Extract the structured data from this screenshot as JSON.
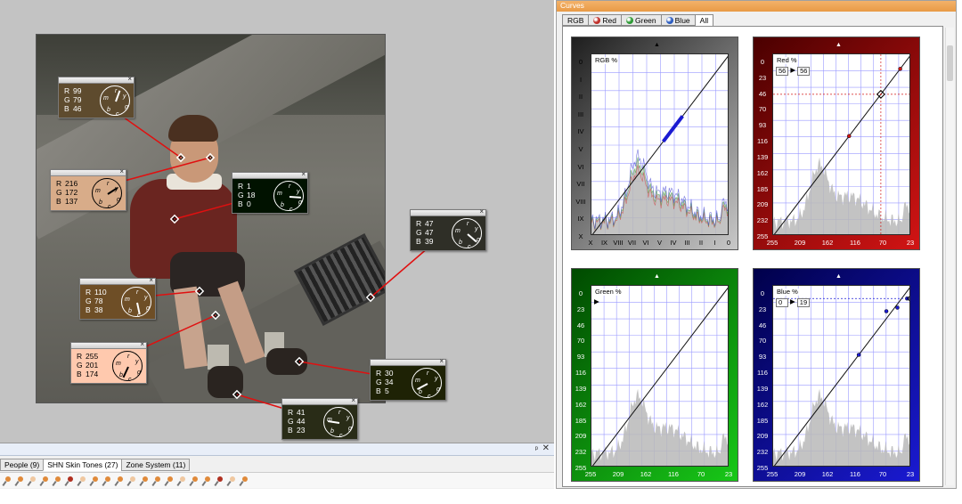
{
  "window": {
    "title": "Curves"
  },
  "curve_tabs": [
    {
      "label": "RGB",
      "ball": ""
    },
    {
      "label": "Red",
      "ball": "#c0302a"
    },
    {
      "label": "Green",
      "ball": "#2e9a35"
    },
    {
      "label": "Blue",
      "ball": "#2b5cc0"
    },
    {
      "label": "All",
      "ball": ""
    }
  ],
  "active_curve_tab": "All",
  "panels": {
    "rgb": {
      "title": "RGB %",
      "y_labels": [
        "0",
        "I",
        "II",
        "III",
        "IV",
        "V",
        "VI",
        "VII",
        "VIII",
        "IX",
        "X"
      ],
      "x_labels": [
        "X",
        "IX",
        "VIII",
        "VII",
        "VI",
        "V",
        "IV",
        "III",
        "II",
        "I",
        "0"
      ],
      "bg_from": "#1e1e1e",
      "bg_to": "#c8c8c8"
    },
    "red": {
      "title": "Red %",
      "readout_in": "56",
      "readout_arrow": "▶",
      "readout_out": "56",
      "y_labels": [
        "0",
        "23",
        "46",
        "70",
        "93",
        "116",
        "139",
        "162",
        "185",
        "209",
        "232",
        "255"
      ],
      "x_labels": [
        "255",
        "209",
        "162",
        "116",
        "70",
        "23"
      ],
      "color": "#d21414",
      "bg_dark": "#4a0000"
    },
    "green": {
      "title": "Green %",
      "readout_arrow": "▶",
      "y_labels": [
        "0",
        "23",
        "46",
        "70",
        "93",
        "116",
        "139",
        "162",
        "185",
        "209",
        "232",
        "255"
      ],
      "x_labels": [
        "255",
        "209",
        "162",
        "116",
        "70",
        "23"
      ],
      "color": "#18c818",
      "bg_dark": "#004a00"
    },
    "blue": {
      "title": "Blue %",
      "readout_in": "0",
      "readout_arrow": "▶",
      "readout_out": "19",
      "y_labels": [
        "0",
        "23",
        "46",
        "70",
        "93",
        "116",
        "139",
        "162",
        "185",
        "209",
        "232",
        "255"
      ],
      "x_labels": [
        "255",
        "209",
        "162",
        "116",
        "70",
        "23"
      ],
      "color": "#1a1ad2",
      "bg_dark": "#00004a"
    }
  },
  "probes": [
    {
      "id": "p1",
      "r": "99",
      "g": "79",
      "b": "46",
      "color": "#5e4b2e",
      "text": "#ffffff"
    },
    {
      "id": "p2",
      "r": "216",
      "g": "172",
      "b": "137",
      "color": "#d8ac89",
      "text": "#000000"
    },
    {
      "id": "p3",
      "r": "1",
      "g": "18",
      "b": "0",
      "color": "#011200",
      "text": "#ffffff"
    },
    {
      "id": "p4",
      "r": "47",
      "g": "47",
      "b": "39",
      "color": "#2f2f27",
      "text": "#ffffff"
    },
    {
      "id": "p5",
      "r": "110",
      "g": "78",
      "b": "38",
      "color": "#6e4e26",
      "text": "#ffffff"
    },
    {
      "id": "p6",
      "r": "255",
      "g": "201",
      "b": "174",
      "color": "#ffc9ae",
      "text": "#000000"
    },
    {
      "id": "p7",
      "r": "30",
      "g": "34",
      "b": "5",
      "color": "#1e2205",
      "text": "#ffffff"
    },
    {
      "id": "p8",
      "r": "41",
      "g": "44",
      "b": "23",
      "color": "#292c17",
      "text": "#ffffff"
    }
  ],
  "dial_letters": [
    "r",
    "y",
    "g",
    "c",
    "b",
    "m"
  ],
  "bottom_panel": {
    "pin_icon": "pin-icon",
    "close_label": "✕",
    "pin_label": "ᵖ",
    "tabs": [
      "People (9)",
      "SHN Skin Tones (27)",
      "Zone System (11)"
    ],
    "active_tab": "SHN Skin Tones (27)",
    "swatch_count": 20
  },
  "probe_close_label": "×",
  "panel_arrow": "▲"
}
